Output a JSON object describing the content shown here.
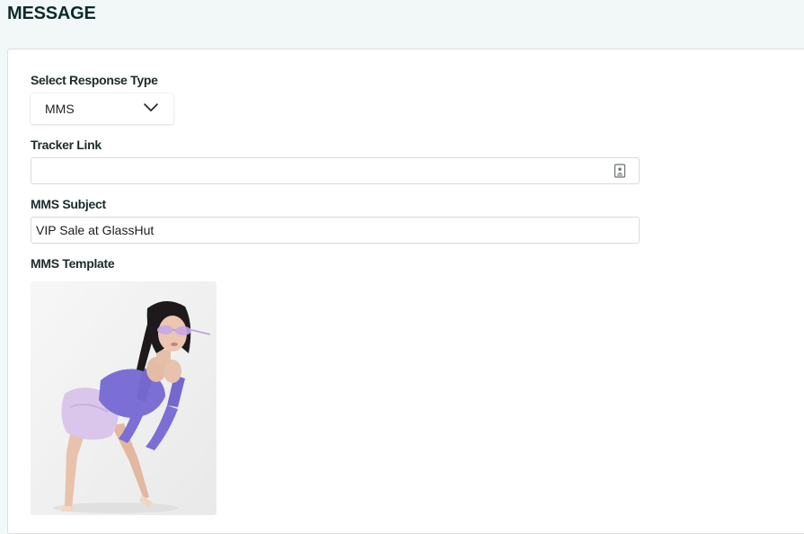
{
  "header": {
    "title": "MESSAGE"
  },
  "form": {
    "response_type": {
      "label": "Select Response Type",
      "value": "MMS"
    },
    "tracker_link": {
      "label": "Tracker Link",
      "value": "",
      "icon": "contact-card-icon"
    },
    "subject": {
      "label": "MMS Subject",
      "value": "VIP Sale at GlassHut"
    },
    "template": {
      "label": "MMS Template",
      "image": "model-in-purple-outfit-with-sunglasses-photo"
    }
  },
  "colors": {
    "page_background": "#f2f7f7",
    "card_background": "#ffffff",
    "heading_text": "#0f2a2a",
    "border": "#d9dcdd",
    "outfit_purple": "#7b6fd6"
  }
}
